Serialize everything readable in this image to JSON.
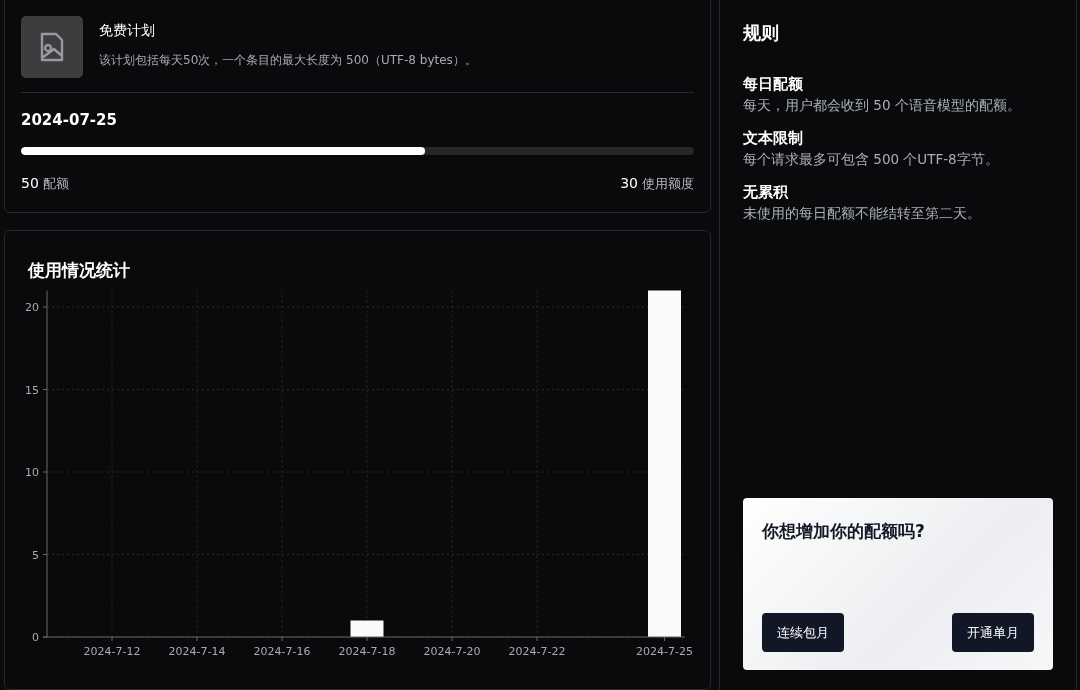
{
  "plan": {
    "name": "免费计划",
    "description": "该计划包括每天50次，一个条目的最大长度为 500（UTF-8 bytes）。",
    "date": "2024-07-25",
    "level": 0.6,
    "quota_value": "50",
    "quota_label": "配额",
    "used_value": "30",
    "used_label": "使用额度"
  },
  "usage": {
    "title": "使用情况统计",
    "chart_data": {
      "type": "bar",
      "categories": [
        null,
        "2024-7-12",
        null,
        "2024-7-14",
        null,
        "2024-7-16",
        null,
        "2024-7-18",
        null,
        "2024-7-20",
        null,
        "2024-7-22",
        null,
        null,
        "2024-7-25"
      ],
      "values": [
        0,
        0,
        0,
        0,
        0,
        0,
        0,
        1,
        0,
        0,
        0,
        0,
        0,
        0,
        21
      ],
      "ylim": [
        0,
        21
      ],
      "yticks": [
        0,
        5,
        10,
        15,
        20
      ],
      "grid": true
    }
  },
  "rules": {
    "title": "规则",
    "items": [
      {
        "title": "每日配额",
        "text": "每天，用户都会收到 50 个语音模型的配额。"
      },
      {
        "title": "文本限制",
        "text": "每个请求最多可包含 500 个UTF-8字节。"
      },
      {
        "title": "无累积",
        "text": "未使用的每日配额不能结转至第二天。"
      }
    ]
  },
  "upsell": {
    "title": "你想增加你的配额吗?",
    "buttons": [
      "连续包月",
      "开通单月"
    ]
  }
}
